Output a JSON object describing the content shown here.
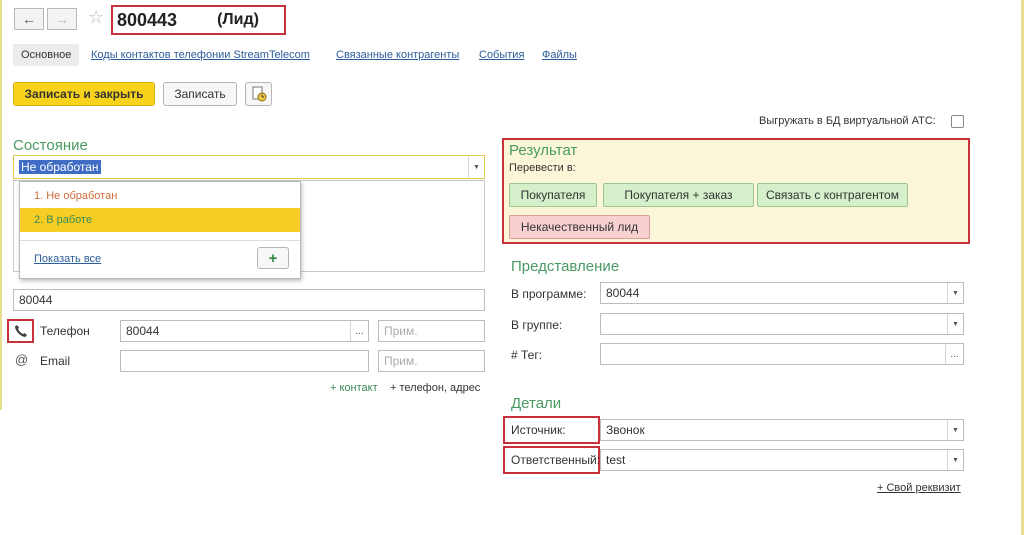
{
  "window": {
    "title": "800443",
    "type_label": "(Лид)"
  },
  "tabs": [
    {
      "label": "Основное"
    },
    {
      "label": "Коды контактов телефонии StreamTelecom"
    },
    {
      "label": "Связанные контрагенты"
    },
    {
      "label": "События"
    },
    {
      "label": "Файлы"
    }
  ],
  "toolbar": {
    "save_close_label": "Записать и закрыть",
    "save_label": "Записать"
  },
  "export": {
    "label": "Выгружать в БД виртуальной АТС:"
  },
  "state": {
    "section_title": "Состояние",
    "selected": "Не обработан",
    "options": [
      "1. Не обработан",
      "2. В работе"
    ],
    "show_all": "Показать все",
    "add_symbol": "+"
  },
  "contacts": {
    "name_value": "80044",
    "phone_label": "Телефон",
    "phone_value": "80044",
    "phone_note_placeholder": "Прим.",
    "email_label": "Email",
    "email_note_placeholder": "Прим.",
    "add_contact": "+ контакт",
    "add_phone_address": "+ телефон, адрес"
  },
  "result": {
    "title": "Результат",
    "transfer_label": "Перевести в:",
    "buttons": [
      "Покупателя",
      "Покупателя + заказ",
      "Связать с контрагентом"
    ],
    "bad_lead_button": "Некачественный лид"
  },
  "representation": {
    "title": "Представление",
    "program_label": "В программе:",
    "program_value": "80044",
    "group_label": "В группе:",
    "tag_label": "# Тег:"
  },
  "details": {
    "title": "Детали",
    "source_label": "Источник:",
    "source_value": "Звонок",
    "responsible_label": "Ответственный:",
    "responsible_value": "test",
    "own_attribute": "+ Свой реквизит"
  },
  "colors": {
    "accent_green": "#4a9a63",
    "highlight_red": "#c8303a",
    "primary_yellow": "#f7d31b",
    "link_blue": "#2b5d9a"
  }
}
